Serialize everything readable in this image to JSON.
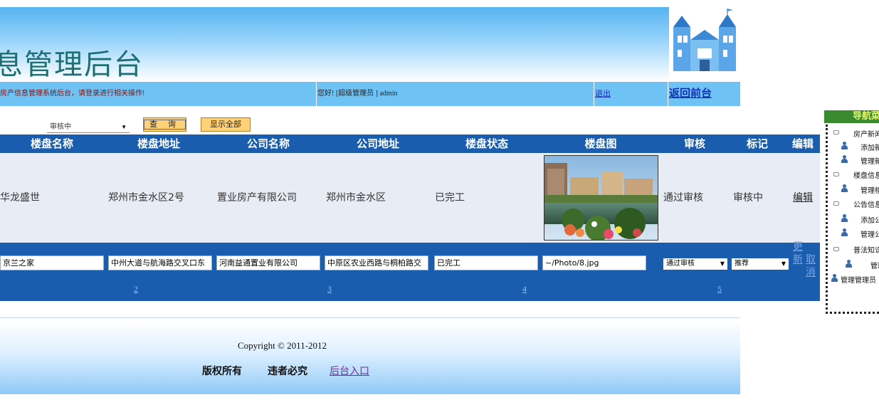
{
  "header": {
    "title": "息管理后台",
    "notice": "房产信息管理系统后台，请登录进行相关操作!",
    "welcome": "您好! [超级管理员 ] admin",
    "logout": "退出",
    "back_front": "返回前台"
  },
  "search": {
    "select_value": "审核中",
    "query_label": "查 询",
    "show_all_label": "显示全部"
  },
  "grid": {
    "columns": [
      "楼盘名称",
      "楼盘地址",
      "公司名称",
      "公司地址",
      "楼盘状态",
      "楼盘图",
      "审核",
      "标记",
      "编辑"
    ],
    "row1": {
      "name": "华龙盛世",
      "address": "郑州市金水区2号",
      "company": "置业房产有限公司",
      "company_address": "郑州市金水区",
      "status": "已完工",
      "audit": "通过审核",
      "mark": "审核中",
      "edit": "编辑"
    },
    "edit_row": {
      "name": "京兰之家",
      "address": "中州大道与航海路交叉口东",
      "company": "河南益通置业有限公司",
      "company_address": "中原区农业西路与桐柏路交",
      "status": "已完工",
      "photo_path": "~/Photo/8.jpg",
      "audit_select": "通过审核",
      "mark_select": "推荐",
      "update": "更新",
      "cancel": "取消"
    },
    "pager": [
      "2",
      "3",
      "4",
      "5"
    ]
  },
  "footer": {
    "copyright": "Copyright © 2011-2012",
    "rights": "版权所有",
    "piracy": "违者必究",
    "admin_link": "后台入口"
  },
  "nav": {
    "title": "导航菜单",
    "items": [
      {
        "label": "房产新闻",
        "type": "folder"
      },
      {
        "label": "添加新闻",
        "type": "user"
      },
      {
        "label": "管理新闻",
        "type": "user"
      },
      {
        "label": "楼盘信息",
        "type": "folder"
      },
      {
        "label": "管理楼盘",
        "type": "user"
      },
      {
        "label": "公告信息",
        "type": "folder"
      },
      {
        "label": "添加公告",
        "type": "user"
      },
      {
        "label": "管理公告",
        "type": "user"
      },
      {
        "label": "普法知识",
        "type": "folder"
      },
      {
        "label": "管理",
        "type": "user"
      },
      {
        "label": "管理管理员",
        "type": "user"
      }
    ]
  },
  "colors": {
    "grid_header": "#1a5cad",
    "info_bar": "#6ec3f4",
    "button": "#ffd27a",
    "nav_title": "#3a8a30"
  }
}
